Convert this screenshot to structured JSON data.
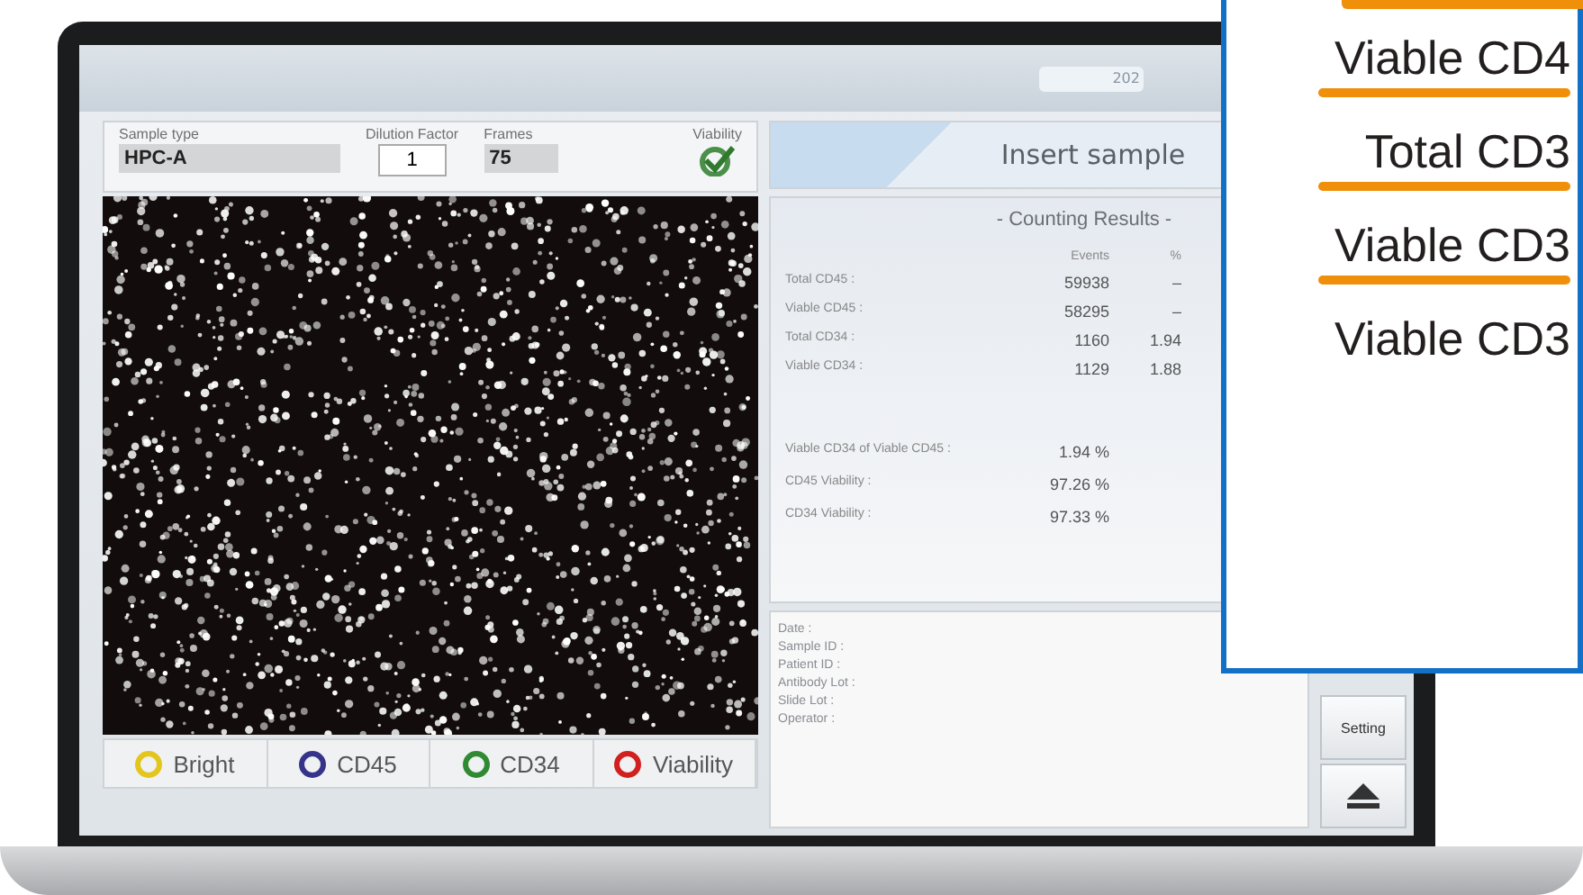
{
  "top_bar": {
    "date_field": "202"
  },
  "sample_panel": {
    "sample_type": {
      "label": "Sample type",
      "value": "HPC-A"
    },
    "dilution": {
      "label": "Dilution Factor",
      "value": "1"
    },
    "frames": {
      "label": "Frames",
      "value": "75"
    },
    "viability": {
      "label": "Viability",
      "checked": true
    }
  },
  "legend": [
    {
      "label": "Bright",
      "color": "#e3c51c"
    },
    {
      "label": "CD45",
      "color": "#35338a"
    },
    {
      "label": "CD34",
      "color": "#2f8a33"
    },
    {
      "label": "Viability",
      "color": "#d2201e"
    }
  ],
  "status": "Insert sample",
  "results": {
    "title": "- Counting Results -",
    "columns": [
      "Events",
      "%"
    ],
    "rows": [
      {
        "label": "Total CD45 :",
        "events": "59938",
        "percent": "–"
      },
      {
        "label": "Viable CD45 :",
        "events": "58295",
        "percent": "–"
      },
      {
        "label": "Total CD34 :",
        "events": "1160",
        "percent": "1.94"
      },
      {
        "label": "Viable CD34 :",
        "events": "1129",
        "percent": "1.88"
      }
    ],
    "summary": [
      {
        "label": "Viable CD34 of Viable CD45 :",
        "value": "1.94 %"
      },
      {
        "label": "CD45 Viability :",
        "value": "97.26 %"
      },
      {
        "label": "CD34 Viability :",
        "value": "97.33 %"
      }
    ]
  },
  "info": [
    "Date :",
    "Sample ID :",
    "Patient ID :",
    "Antibody Lot :",
    "Slide Lot :",
    "Operator :"
  ],
  "buttons": [
    {
      "kind": "text",
      "label": "Setting"
    },
    {
      "kind": "eject"
    }
  ],
  "callout": [
    {
      "text": "Viable CD4",
      "underlined": true
    },
    {
      "text": "Total CD3",
      "underlined": true
    },
    {
      "text": "Viable CD3",
      "underlined": true
    },
    {
      "text": "Viable CD3",
      "underlined": false
    }
  ]
}
